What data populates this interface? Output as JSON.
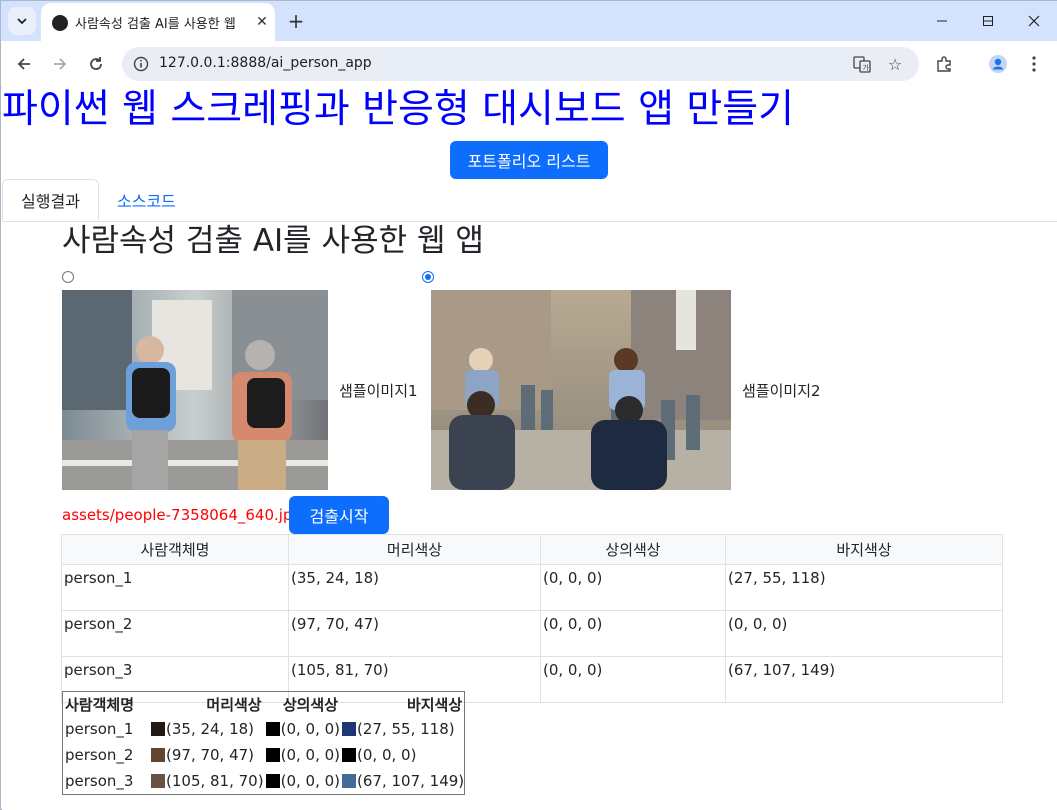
{
  "browser": {
    "tab_title": "사람속성 검출 AI를 사용한 웹",
    "url": "127.0.0.1:8888/ai_person_app"
  },
  "page": {
    "title": "파이썬 웹 스크레핑과 반응형 대시보드 앱 만들기",
    "portfolio_button": "포트폴리오 리스트",
    "tabs": [
      {
        "label": "실행결과",
        "active": true
      },
      {
        "label": "소스코드",
        "active": false
      }
    ],
    "app_title": "사람속성 검출 AI를 사용한 웹 앱",
    "samples": [
      {
        "label": "샘플이미지1",
        "selected": false
      },
      {
        "label": "샘플이미지2",
        "selected": true
      }
    ],
    "selected_file": "assets/people-7358064_640.jpg",
    "detect_button": "검출시작"
  },
  "results_table": {
    "headers": [
      "사람객체명",
      "머리색상",
      "상의색상",
      "바지색상"
    ],
    "rows": [
      [
        "person_1",
        "(35, 24, 18)",
        "(0, 0, 0)",
        "(27, 55, 118)"
      ],
      [
        "person_2",
        "(97, 70, 47)",
        "(0, 0, 0)",
        "(0, 0, 0)"
      ],
      [
        "person_3",
        "(105, 81, 70)",
        "(0, 0, 0)",
        "(67, 107, 149)"
      ]
    ]
  },
  "swatch_table": {
    "headers": [
      "사람객체명",
      "머리색상",
      "상의색상",
      "바지색상"
    ],
    "rows": [
      {
        "name": "person_1",
        "hair": "(35, 24, 18)",
        "hair_color": "#231812",
        "top": "(0, 0, 0)",
        "top_color": "#000000",
        "pants": "(27, 55, 118)",
        "pants_color": "#1b3776"
      },
      {
        "name": "person_2",
        "hair": "(97, 70, 47)",
        "hair_color": "#61462f",
        "top": "(0, 0, 0)",
        "top_color": "#000000",
        "pants": "(0, 0, 0)",
        "pants_color": "#000000"
      },
      {
        "name": "person_3",
        "hair": "(105, 81, 70)",
        "hair_color": "#695146",
        "top": "(0, 0, 0)",
        "top_color": "#000000",
        "pants": "(67, 107, 149)",
        "pants_color": "#436b95"
      }
    ]
  }
}
